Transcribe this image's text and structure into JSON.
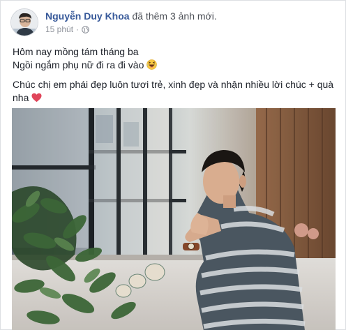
{
  "post": {
    "author": "Nguyễn Duy Khoa",
    "action": "đã thêm 3 ảnh mới.",
    "time": "15 phút",
    "separator": "·",
    "privacy_icon": "globe-icon",
    "line1": "Hôm nay mồng tám tháng ba",
    "line2": "Ngồi ngắm phụ nữ đi ra đi vào",
    "line2_emoji": "laughing-emoji",
    "line3": "Chúc chị em phái đẹp luôn tươi trẻ, xinh đẹp và nhận nhiều lời chúc + quà nha",
    "line3_emoji": "heart-emoji"
  },
  "colors": {
    "author_link": "#365899",
    "body_text": "#1d2129",
    "meta_text": "#90949c",
    "heart": "#e0455a"
  }
}
